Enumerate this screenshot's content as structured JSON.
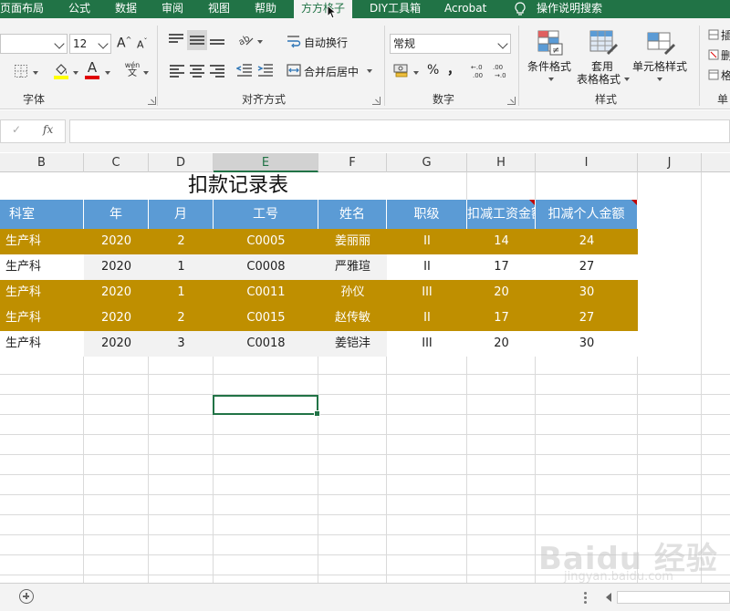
{
  "menu": {
    "items": [
      "页面布局",
      "公式",
      "数据",
      "审阅",
      "视图",
      "帮助",
      "方方格子",
      "DIY工具箱",
      "Acrobat",
      "操作说明搜索"
    ],
    "active": "方方格子"
  },
  "ribbon": {
    "font_size": "12",
    "number_format": "常规",
    "wrap_text": "自动换行",
    "merge_center": "合并后居中",
    "percent": "%",
    "comma": "，",
    "font_label": "字体",
    "align_label": "对齐方式",
    "number_label": "数字",
    "styles_label": "样式",
    "cond_format": "条件格式",
    "table_format_1": "套用",
    "table_format_2": "表格格式",
    "cell_style": "单元格样式",
    "cells_label": "单",
    "font_grow": "A",
    "font_shrink": "A",
    "font_color_letter": "A",
    "wen_letter": "wén",
    "wen_char": "文",
    "right_cut_1": "插",
    "right_cut_2": "删",
    "right_cut_3": "格"
  },
  "formula_bar": {
    "check": "✓",
    "fx": "fx",
    "value": ""
  },
  "columns": [
    "B",
    "C",
    "D",
    "E",
    "F",
    "G",
    "H",
    "I",
    "J"
  ],
  "selected_column": "E",
  "sheet": {
    "title": "扣款记录表",
    "headers": [
      "科室",
      "年",
      "月",
      "工号",
      "姓名",
      "职级",
      "扣减工资金额",
      "扣减个人金额"
    ],
    "rows": [
      [
        "生产科",
        "2020",
        "2",
        "C0005",
        "姜丽丽",
        "II",
        "14",
        "24"
      ],
      [
        "生产科",
        "2020",
        "1",
        "C0008",
        "严雅瑄",
        "II",
        "17",
        "27"
      ],
      [
        "生产科",
        "2020",
        "1",
        "C0011",
        "孙仪",
        "III",
        "20",
        "30"
      ],
      [
        "生产科",
        "2020",
        "2",
        "C0015",
        "赵传敏",
        "II",
        "17",
        "27"
      ],
      [
        "生产科",
        "2020",
        "3",
        "C0018",
        "姜铠沣",
        "III",
        "20",
        "30"
      ]
    ],
    "row_styles": [
      "gold",
      "plain",
      "gold",
      "gold",
      "plain"
    ]
  },
  "colors": {
    "accent": "#217346",
    "header_fill": "#5b9bd5",
    "highlight_fill": "#bf8f00"
  },
  "watermark": {
    "brand": "Baidu 经验",
    "url": "jingyan.baidu.com"
  }
}
